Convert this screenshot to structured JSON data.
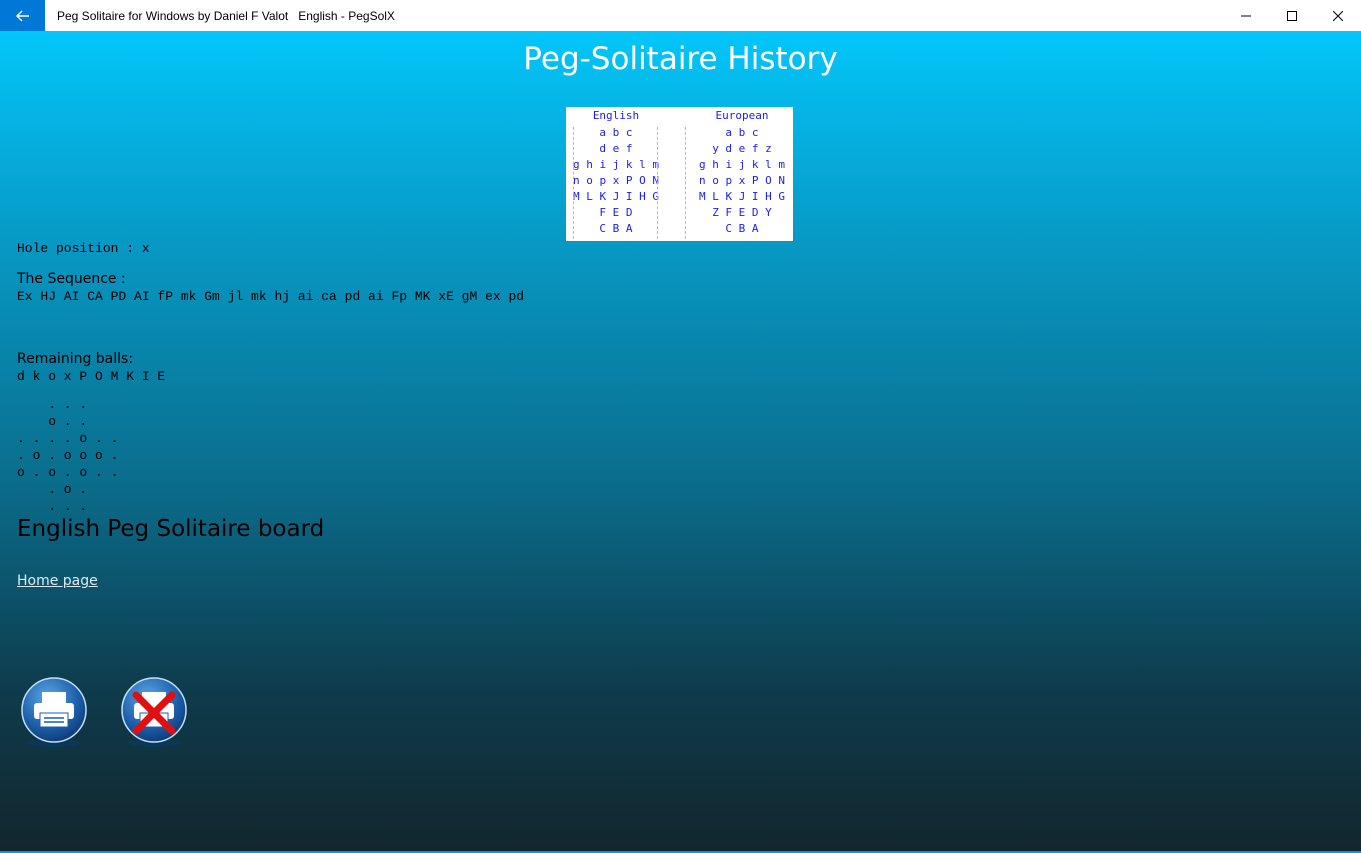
{
  "window": {
    "title": "Peg Solitaire for Windows by Daniel F Valot   English - PegSolX"
  },
  "page": {
    "title": "Peg-Solitaire History"
  },
  "legend": {
    "english": {
      "header": "English",
      "rows": [
        "  a b c  ",
        "  d e f  ",
        "g h i j k l m",
        "n o p x P O N",
        "M L K J I H G",
        "  F E D  ",
        "  C B A  "
      ]
    },
    "european": {
      "header": "European",
      "rows": [
        "  a b c  ",
        "y d e f z",
        "g h i j k l m",
        "n o p x P O N",
        "M L K J I H G",
        "Z F E D Y",
        "  C B A  "
      ]
    }
  },
  "hole_position": "Hole position : x",
  "sequence": {
    "label": "The Sequence :",
    "value": "Ex HJ AI CA PD AI fP mk Gm jl mk hj ai ca pd ai Fp MK xE gM ex pd"
  },
  "remaining": {
    "label": "Remaining balls:",
    "value": "d k o x P O M K I E"
  },
  "board": {
    "rows": [
      "    . . .",
      "    o . .",
      ". . . . o . .",
      ". o . o o o .",
      "o . o . o . .",
      "    . o .",
      "    . . ."
    ],
    "title": "English Peg Solitaire board"
  },
  "home_link": "Home page",
  "colors": {
    "accent": "#0078d7",
    "gradient_top": "#03c6fa",
    "gradient_bottom": "#12262d",
    "legend_text": "#1a1aff"
  },
  "icons": {
    "back": "arrow-left-icon",
    "print": "printer-icon",
    "cancel_print": "printer-cancel-icon"
  }
}
